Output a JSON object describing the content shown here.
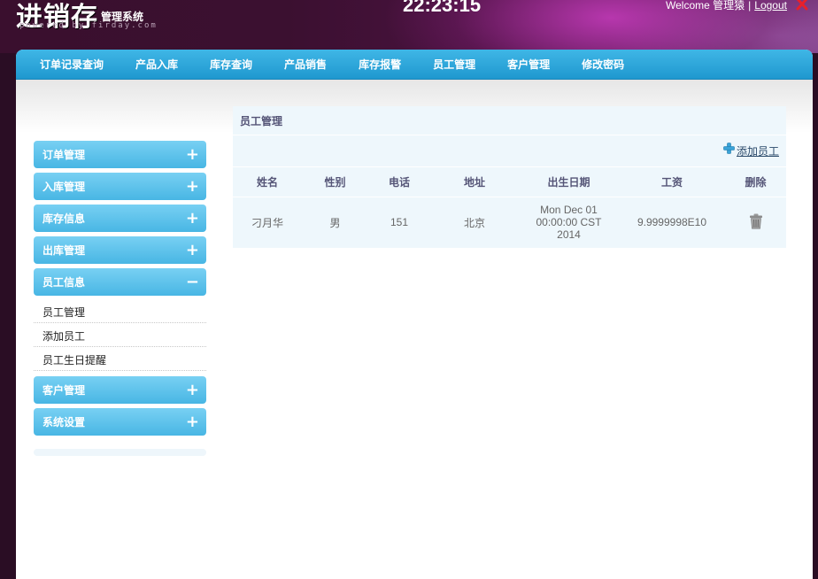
{
  "header": {
    "logo_main": "进销存",
    "logo_sub": "管理系统",
    "powered": "powered by firday.com",
    "clock": "22:23:15",
    "welcome_text": "Welcome 管理猿",
    "separator": "|",
    "logout_label": "Logout"
  },
  "nav": {
    "items": [
      "订单记录查询",
      "产品入库",
      "库存查询",
      "产品销售",
      "库存报警",
      "员工管理",
      "客户管理",
      "修改密码"
    ]
  },
  "sidebar": {
    "menus": [
      {
        "label": "订单管理",
        "toggle": "+"
      },
      {
        "label": "入库管理",
        "toggle": "+"
      },
      {
        "label": "库存信息",
        "toggle": "+"
      },
      {
        "label": "出库管理",
        "toggle": "+"
      },
      {
        "label": "员工信息",
        "toggle": "−"
      },
      {
        "label": "客户管理",
        "toggle": "+"
      },
      {
        "label": "系统设置",
        "toggle": "+"
      }
    ],
    "employee_submenu": [
      "员工管理",
      "添加员工",
      "员工生日提醒"
    ]
  },
  "content": {
    "title": "员工管理",
    "add_label": "添加员工",
    "columns": [
      "姓名",
      "性别",
      "电话",
      "地址",
      "出生日期",
      "工资",
      "删除"
    ],
    "rows": [
      {
        "name": "刁月华",
        "gender": "男",
        "phone": "151",
        "address": "北京",
        "birth_line1": "Mon Dec 01",
        "birth_line2": "00:00:00 CST",
        "birth_line3": "2014",
        "salary": "9.9999998E10"
      }
    ]
  },
  "colors": {
    "nav_blue": "#1f98cf",
    "menu_blue": "#48b6e4",
    "content_bg": "#eef7fc"
  }
}
